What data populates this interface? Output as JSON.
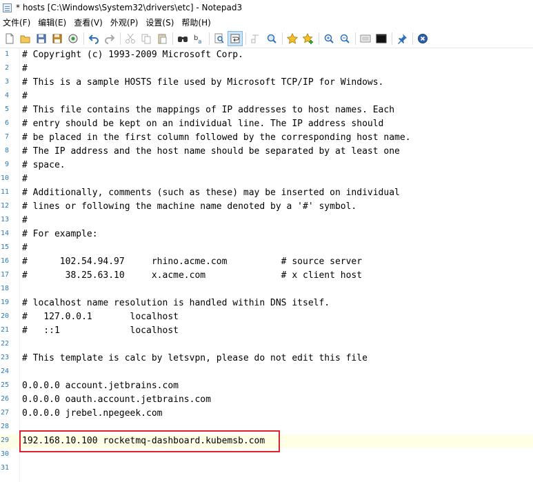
{
  "window": {
    "title": "* hosts [C:\\Windows\\System32\\drivers\\etc] - Notepad3"
  },
  "menu": [
    {
      "label": "文件(F)"
    },
    {
      "label": "编辑(E)"
    },
    {
      "label": "查看(V)"
    },
    {
      "label": "外观(P)"
    },
    {
      "label": "设置(S)"
    },
    {
      "label": "帮助(H)"
    }
  ],
  "toolbar": {
    "buttons": [
      "new-icon",
      "open-icon",
      "save-icon",
      "save-as-icon",
      "browse-icon",
      "undo-icon",
      "redo-icon",
      "cut-icon",
      "copy-icon",
      "paste-icon",
      "find-icon",
      "replace-icon",
      "zoom-find-icon",
      "word-wrap-icon",
      "view-whitespace-icon",
      "zoom-icon",
      "favorite-icon",
      "add-favorite-icon",
      "zoom-in-icon",
      "zoom-out-icon",
      "settings-icon",
      "console-icon",
      "pin-icon",
      "exit-icon"
    ],
    "active_button": "word-wrap-icon"
  },
  "editor": {
    "current_line": 29,
    "highlighted_line": 29,
    "lines": [
      {
        "num": "1",
        "text": "# Copyright (c) 1993-2009 Microsoft Corp."
      },
      {
        "num": "2",
        "text": "#"
      },
      {
        "num": "3",
        "text": "# This is a sample HOSTS file used by Microsoft TCP/IP for Windows."
      },
      {
        "num": "4",
        "text": "#"
      },
      {
        "num": "5",
        "text": "# This file contains the mappings of IP addresses to host names. Each"
      },
      {
        "num": "6",
        "text": "# entry should be kept on an individual line. The IP address should"
      },
      {
        "num": "7",
        "text": "# be placed in the first column followed by the corresponding host name."
      },
      {
        "num": "8",
        "text": "# The IP address and the host name should be separated by at least one"
      },
      {
        "num": "9",
        "text": "# space."
      },
      {
        "num": "10",
        "text": "#"
      },
      {
        "num": "11",
        "text": "# Additionally, comments (such as these) may be inserted on individual"
      },
      {
        "num": "12",
        "text": "# lines or following the machine name denoted by a '#' symbol."
      },
      {
        "num": "13",
        "text": "#"
      },
      {
        "num": "14",
        "text": "# For example:"
      },
      {
        "num": "15",
        "text": "#"
      },
      {
        "num": "16",
        "text": "#      102.54.94.97     rhino.acme.com          # source server"
      },
      {
        "num": "17",
        "text": "#       38.25.63.10     x.acme.com              # x client host"
      },
      {
        "num": "18",
        "text": ""
      },
      {
        "num": "19",
        "text": "# localhost name resolution is handled within DNS itself."
      },
      {
        "num": "20",
        "text": "#   127.0.0.1       localhost"
      },
      {
        "num": "21",
        "text": "#   ::1             localhost"
      },
      {
        "num": "22",
        "text": ""
      },
      {
        "num": "23",
        "text": "# This template is calc by letsvpn, please do not edit this file"
      },
      {
        "num": "24",
        "text": ""
      },
      {
        "num": "25",
        "text": "0.0.0.0 account.jetbrains.com"
      },
      {
        "num": "26",
        "text": "0.0.0.0 oauth.account.jetbrains.com"
      },
      {
        "num": "27",
        "text": "0.0.0.0 jrebel.npegeek.com"
      },
      {
        "num": "28",
        "text": ""
      },
      {
        "num": "29",
        "text": "192.168.10.100 rocketmq-dashboard.kubemsb.com"
      },
      {
        "num": "30",
        "text": ""
      },
      {
        "num": "31",
        "text": ""
      }
    ]
  },
  "colors": {
    "line_number": "#2b7ab8",
    "current_line_bg": "#ffffe5",
    "highlight_border": "#e0202a"
  }
}
